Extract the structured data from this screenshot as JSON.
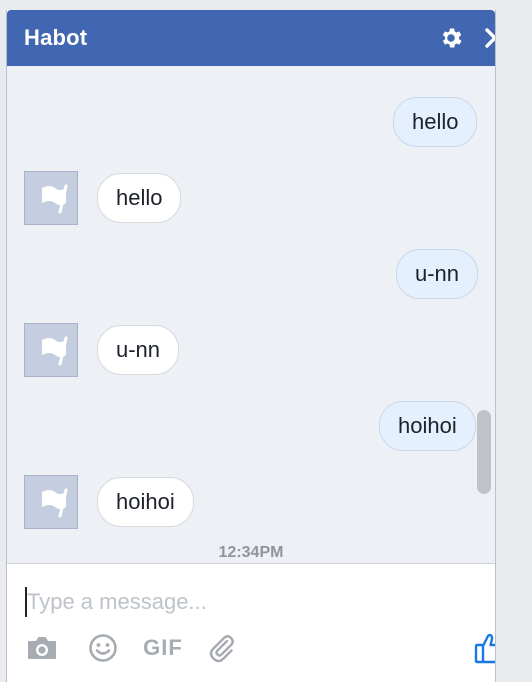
{
  "window": {
    "title": "Habot"
  },
  "icons": {
    "settings": "gear-icon",
    "close": "close-icon",
    "avatar": "flag-icon",
    "camera": "camera-icon",
    "emoji": "smiley-icon",
    "attach": "paperclip-icon",
    "like": "thumbs-up-icon"
  },
  "messages": [
    {
      "side": "out",
      "text": "hello"
    },
    {
      "side": "in",
      "text": "hello"
    },
    {
      "side": "out",
      "text": "u-nn"
    },
    {
      "side": "in",
      "text": "u-nn"
    },
    {
      "side": "out",
      "text": "hoihoi"
    },
    {
      "side": "in",
      "text": "hoihoi"
    }
  ],
  "timestamp": "12:34PM",
  "composer": {
    "placeholder": "Type a message...",
    "value": "",
    "gif_label": "GIF"
  },
  "colors": {
    "header": "#4267b2",
    "outgoing_bubble": "#e4f0fd",
    "incoming_bubble": "#ffffff",
    "like": "#1a78e6"
  }
}
